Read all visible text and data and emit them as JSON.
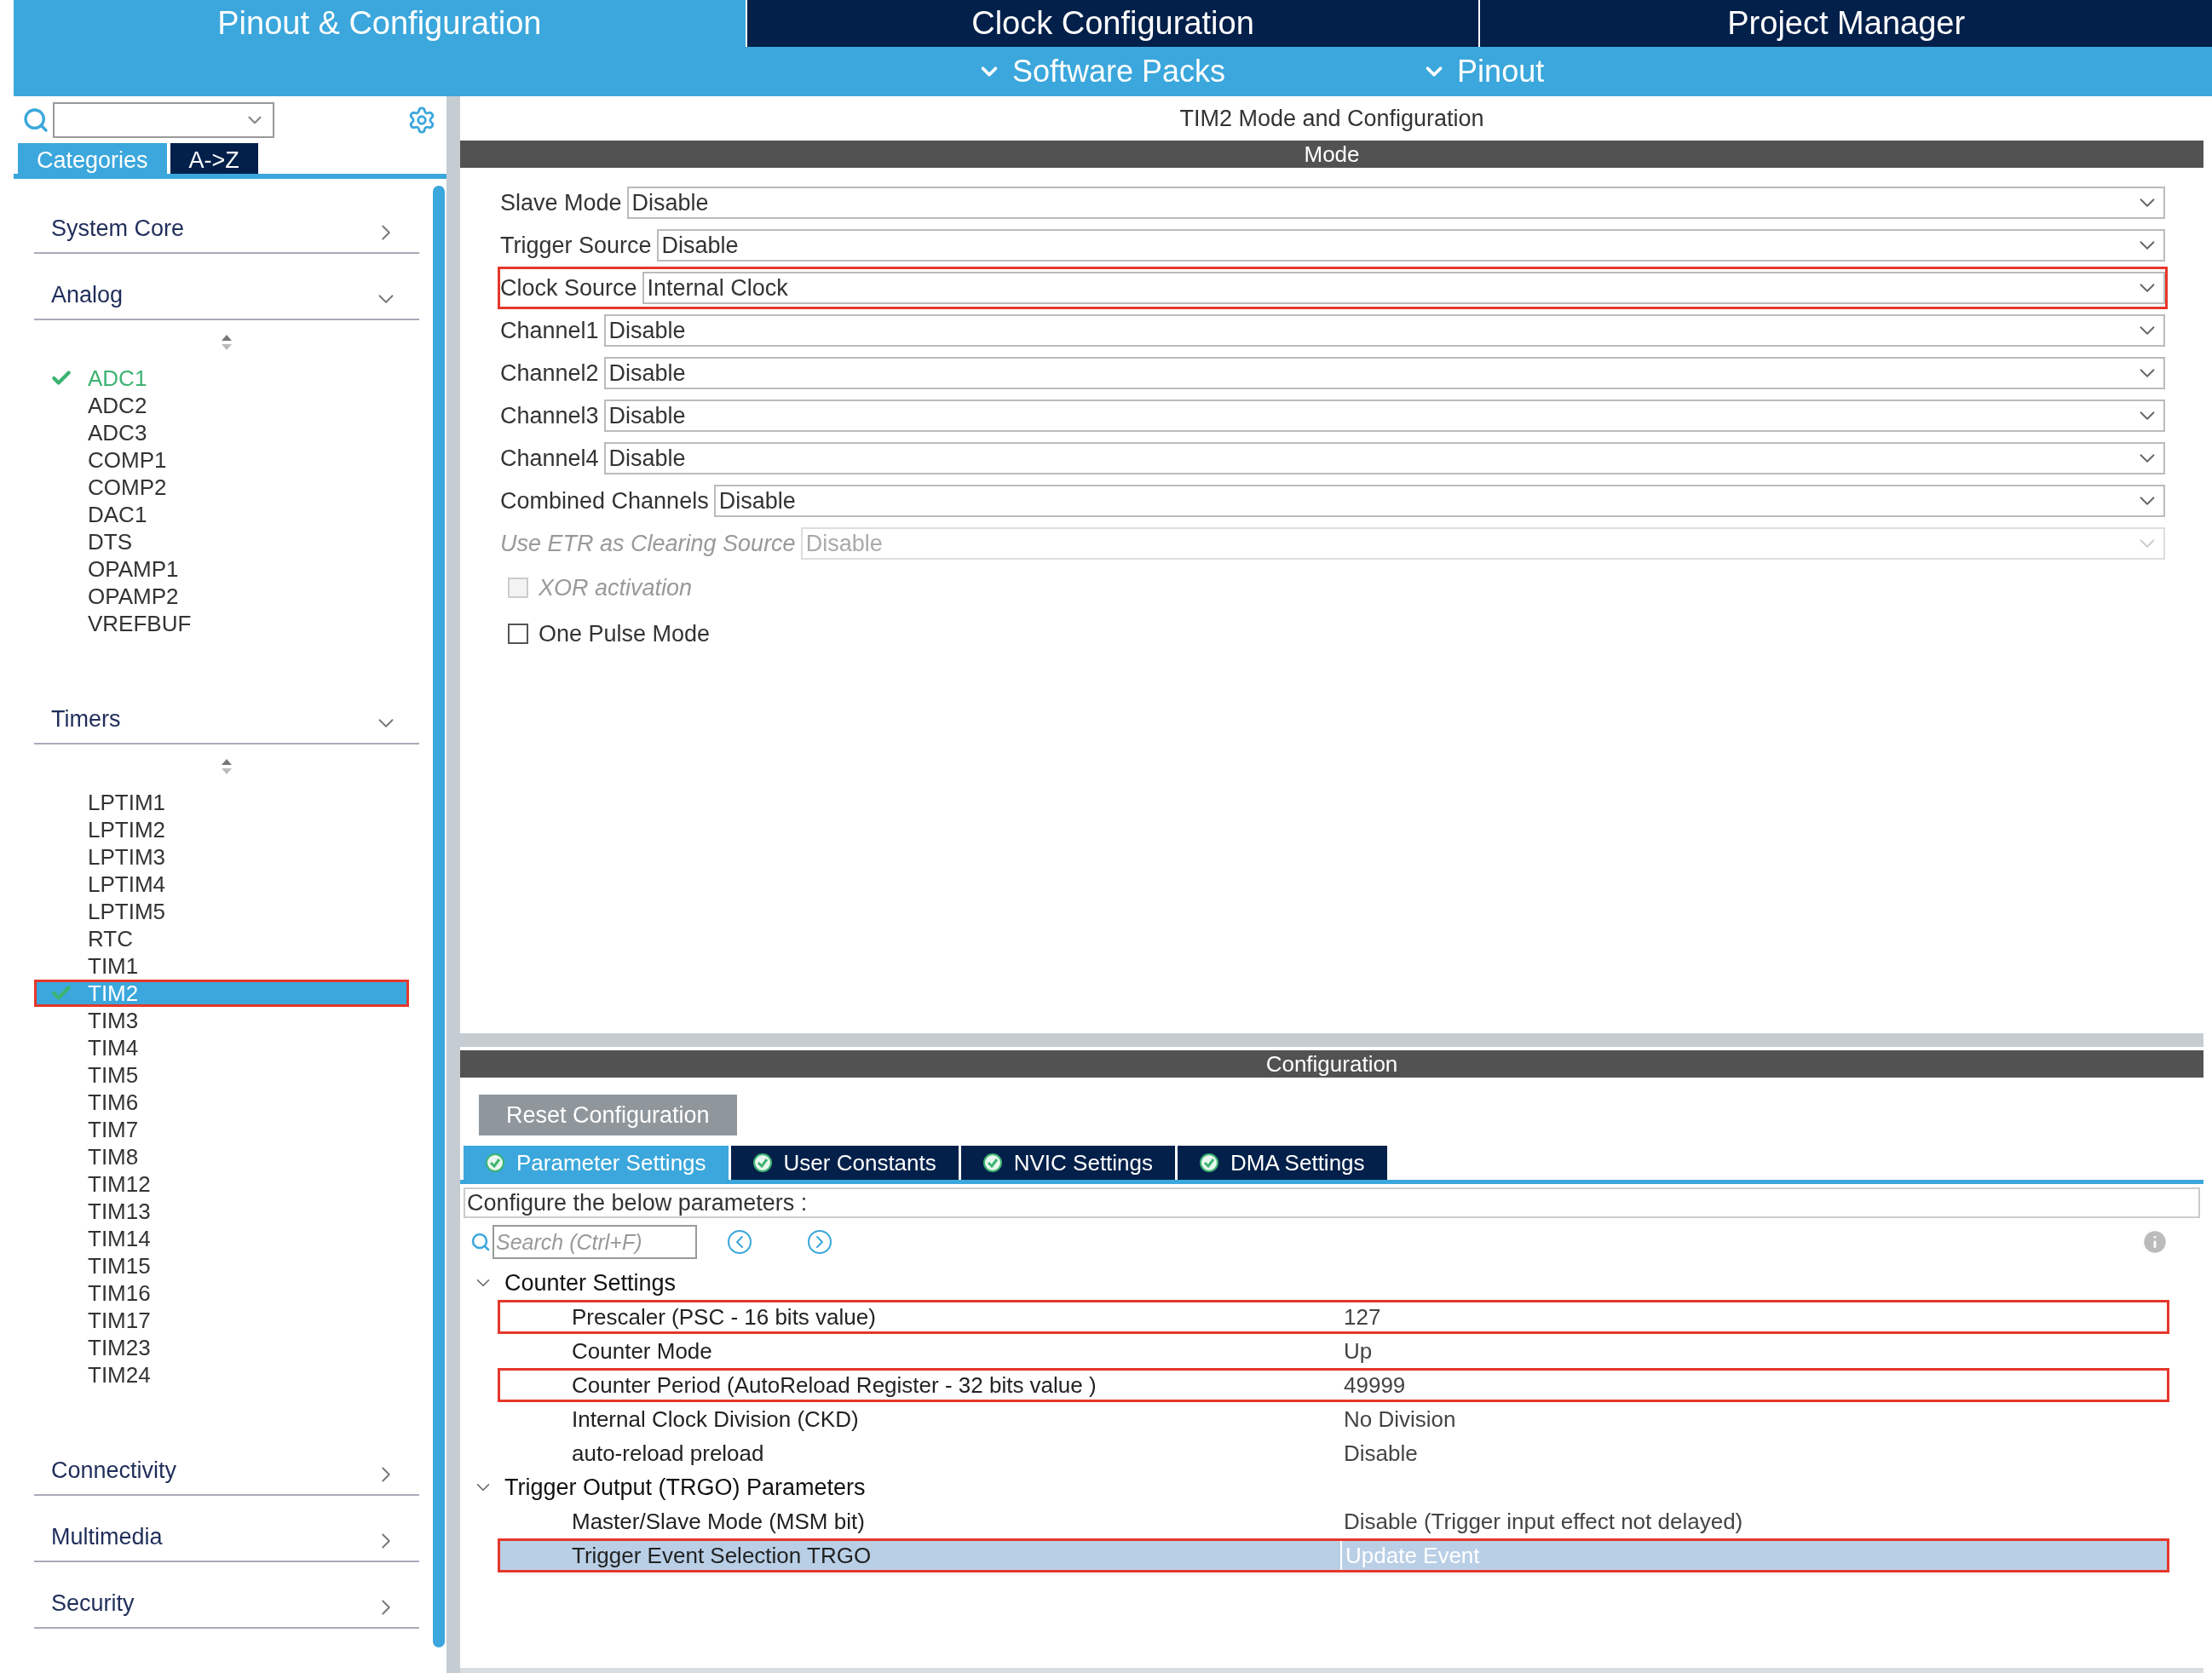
{
  "top_tabs": [
    {
      "label": "Pinout & Configuration",
      "selected": true
    },
    {
      "label": "Clock Configuration",
      "selected": false
    },
    {
      "label": "Project Manager",
      "selected": false
    }
  ],
  "sub_menu": [
    "Software Packs",
    "Pinout"
  ],
  "sidebar": {
    "view_tabs": [
      {
        "label": "Categories",
        "selected": true
      },
      {
        "label": "A->Z",
        "selected": false
      }
    ],
    "categories": [
      {
        "label": "System Core",
        "expanded": false
      },
      {
        "label": "Analog",
        "expanded": true,
        "items": [
          {
            "label": "ADC1",
            "checked": true,
            "selected": false,
            "outlined": false
          },
          {
            "label": "ADC2",
            "checked": false,
            "selected": false,
            "outlined": false
          },
          {
            "label": "ADC3",
            "checked": false,
            "selected": false,
            "outlined": false
          },
          {
            "label": "COMP1",
            "checked": false,
            "selected": false,
            "outlined": false
          },
          {
            "label": "COMP2",
            "checked": false,
            "selected": false,
            "outlined": false
          },
          {
            "label": "DAC1",
            "checked": false,
            "selected": false,
            "outlined": false
          },
          {
            "label": "DTS",
            "checked": false,
            "selected": false,
            "outlined": false
          },
          {
            "label": "OPAMP1",
            "checked": false,
            "selected": false,
            "outlined": false
          },
          {
            "label": "OPAMP2",
            "checked": false,
            "selected": false,
            "outlined": false
          },
          {
            "label": "VREFBUF",
            "checked": false,
            "selected": false,
            "outlined": false
          }
        ]
      },
      {
        "label": "Timers",
        "expanded": true,
        "items": [
          {
            "label": "LPTIM1",
            "checked": false,
            "selected": false,
            "outlined": false
          },
          {
            "label": "LPTIM2",
            "checked": false,
            "selected": false,
            "outlined": false
          },
          {
            "label": "LPTIM3",
            "checked": false,
            "selected": false,
            "outlined": false
          },
          {
            "label": "LPTIM4",
            "checked": false,
            "selected": false,
            "outlined": false
          },
          {
            "label": "LPTIM5",
            "checked": false,
            "selected": false,
            "outlined": false
          },
          {
            "label": "RTC",
            "checked": false,
            "selected": false,
            "outlined": false
          },
          {
            "label": "TIM1",
            "checked": false,
            "selected": false,
            "outlined": false
          },
          {
            "label": "TIM2",
            "checked": true,
            "selected": true,
            "outlined": true
          },
          {
            "label": "TIM3",
            "checked": false,
            "selected": false,
            "outlined": false
          },
          {
            "label": "TIM4",
            "checked": false,
            "selected": false,
            "outlined": false
          },
          {
            "label": "TIM5",
            "checked": false,
            "selected": false,
            "outlined": false
          },
          {
            "label": "TIM6",
            "checked": false,
            "selected": false,
            "outlined": false
          },
          {
            "label": "TIM7",
            "checked": false,
            "selected": false,
            "outlined": false
          },
          {
            "label": "TIM8",
            "checked": false,
            "selected": false,
            "outlined": false
          },
          {
            "label": "TIM12",
            "checked": false,
            "selected": false,
            "outlined": false
          },
          {
            "label": "TIM13",
            "checked": false,
            "selected": false,
            "outlined": false
          },
          {
            "label": "TIM14",
            "checked": false,
            "selected": false,
            "outlined": false
          },
          {
            "label": "TIM15",
            "checked": false,
            "selected": false,
            "outlined": false
          },
          {
            "label": "TIM16",
            "checked": false,
            "selected": false,
            "outlined": false
          },
          {
            "label": "TIM17",
            "checked": false,
            "selected": false,
            "outlined": false
          },
          {
            "label": "TIM23",
            "checked": false,
            "selected": false,
            "outlined": false
          },
          {
            "label": "TIM24",
            "checked": false,
            "selected": false,
            "outlined": false
          }
        ]
      },
      {
        "label": "Connectivity",
        "expanded": false
      },
      {
        "label": "Multimedia",
        "expanded": false
      },
      {
        "label": "Security",
        "expanded": false
      }
    ]
  },
  "panel_title": "TIM2 Mode and Configuration",
  "mode": {
    "header": "Mode",
    "fields": [
      {
        "kind": "select",
        "label": "Slave Mode",
        "value": "Disable",
        "disabled": false,
        "outlined": false
      },
      {
        "kind": "select",
        "label": "Trigger Source",
        "value": "Disable",
        "disabled": false,
        "outlined": false
      },
      {
        "kind": "select",
        "label": "Clock Source",
        "value": "Internal Clock",
        "disabled": false,
        "outlined": true
      },
      {
        "kind": "select",
        "label": "Channel1",
        "value": "Disable",
        "disabled": false,
        "outlined": false
      },
      {
        "kind": "select",
        "label": "Channel2",
        "value": "Disable",
        "disabled": false,
        "outlined": false
      },
      {
        "kind": "select",
        "label": "Channel3",
        "value": "Disable",
        "disabled": false,
        "outlined": false
      },
      {
        "kind": "select",
        "label": "Channel4",
        "value": "Disable",
        "disabled": false,
        "outlined": false
      },
      {
        "kind": "select",
        "label": "Combined Channels",
        "value": "Disable",
        "disabled": false,
        "outlined": false
      },
      {
        "kind": "select",
        "label": "Use ETR as Clearing Source",
        "value": "Disable",
        "disabled": true,
        "outlined": false
      },
      {
        "kind": "checkbox",
        "label": "XOR activation",
        "checked": false,
        "disabled": true
      },
      {
        "kind": "checkbox",
        "label": "One Pulse Mode",
        "checked": false,
        "disabled": false
      }
    ]
  },
  "configuration": {
    "header": "Configuration",
    "reset_button": "Reset Configuration",
    "tabs": [
      {
        "label": "Parameter Settings",
        "selected": true
      },
      {
        "label": "User Constants",
        "selected": false
      },
      {
        "label": "NVIC Settings",
        "selected": false
      },
      {
        "label": "DMA Settings",
        "selected": false
      }
    ],
    "description": "Configure the below parameters :",
    "search": {
      "placeholder": "Search (Ctrl+F)"
    },
    "groups": [
      {
        "label": "Counter Settings",
        "expanded": true,
        "children": [
          {
            "label": "Prescaler (PSC - 16 bits value)",
            "value": "127",
            "selected": false,
            "outlined": true
          },
          {
            "label": "Counter Mode",
            "value": "Up",
            "selected": false,
            "outlined": false
          },
          {
            "label": "Counter Period (AutoReload Register - 32 bits value )",
            "value": "49999",
            "selected": false,
            "outlined": true
          },
          {
            "label": "Internal Clock Division (CKD)",
            "value": "No Division",
            "selected": false,
            "outlined": false
          },
          {
            "label": "auto-reload preload",
            "value": "Disable",
            "selected": false,
            "outlined": false
          }
        ]
      },
      {
        "label": "Trigger Output (TRGO) Parameters",
        "expanded": true,
        "children": [
          {
            "label": "Master/Slave Mode (MSM bit)",
            "value": "Disable (Trigger input effect not delayed)",
            "selected": false,
            "outlined": false
          },
          {
            "label": "Trigger Event Selection TRGO",
            "value": "Update Event",
            "selected": true,
            "outlined": true
          }
        ]
      }
    ]
  }
}
